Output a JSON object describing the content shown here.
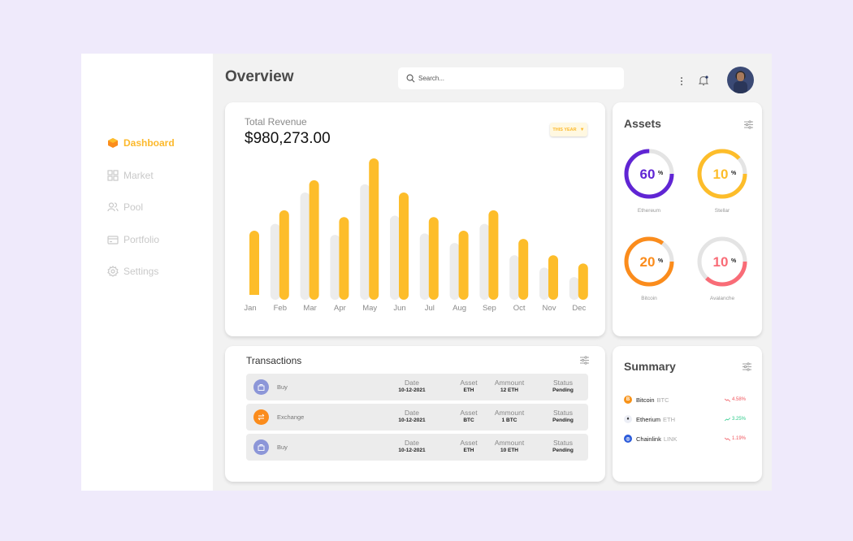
{
  "sidebar": {
    "items": [
      {
        "label": "Dashboard",
        "icon": "cube-icon",
        "active": true
      },
      {
        "label": "Market",
        "icon": "grid-icon",
        "active": false
      },
      {
        "label": "Pool",
        "icon": "users-icon",
        "active": false
      },
      {
        "label": "Portfolio",
        "icon": "card-icon",
        "active": false
      },
      {
        "label": "Settings",
        "icon": "gear-icon",
        "active": false
      }
    ]
  },
  "header": {
    "title": "Overview",
    "search_placeholder": "Search...",
    "search_value": ""
  },
  "revenue": {
    "label": "Total Revenue",
    "value": "$980,273.00",
    "period": "THIS YEAR"
  },
  "chart_data": {
    "type": "bar",
    "title": "Total Revenue",
    "categories": [
      "Jan",
      "Feb",
      "Mar",
      "Apr",
      "May",
      "Jun",
      "Jul",
      "Aug",
      "Sep",
      "Oct",
      "Nov",
      "Dec"
    ],
    "series": [
      {
        "name": "previous",
        "color": "#ececec",
        "values": [
          0,
          52,
          75,
          44,
          81,
          58,
          45,
          38,
          52,
          29,
          20,
          13
        ]
      },
      {
        "name": "current",
        "color": "#fdbd2a",
        "values": [
          47,
          62,
          84,
          57,
          100,
          75,
          57,
          47,
          62,
          41,
          29,
          23
        ]
      }
    ],
    "xlabel": "",
    "ylabel": "",
    "ylim": [
      0,
      100
    ],
    "grid": false
  },
  "assets": {
    "title": "Assets",
    "items": [
      {
        "name": "Ethereum",
        "percent": "60",
        "fill": 0.75,
        "color": "#6025d4"
      },
      {
        "name": "Stellar",
        "percent": "10",
        "fill": 0.88,
        "color": "#fdbd2a"
      },
      {
        "name": "Bitcoin",
        "percent": "20",
        "fill": 0.85,
        "color": "#fb8c1c"
      },
      {
        "name": "Avalanche",
        "percent": "10",
        "fill": 0.37,
        "color": "#f96c77"
      }
    ],
    "percent_sign": "%"
  },
  "transactions": {
    "title": "Transactions",
    "headers": {
      "date": "Date",
      "asset": "Asset",
      "amount": "Ammount",
      "status": "Status"
    },
    "rows": [
      {
        "type": "Buy",
        "icon": "bag-icon",
        "color": "#8c96d8",
        "date": "10-12-2021",
        "asset": "ETH",
        "amount": "12 ETH",
        "status": "Pending"
      },
      {
        "type": "Exchange",
        "icon": "exchange-icon",
        "color": "#fb8c1c",
        "date": "10-12-2021",
        "asset": "BTC",
        "amount": "1 BTC",
        "status": "Pending"
      },
      {
        "type": "Buy",
        "icon": "bag-icon",
        "color": "#8c96d8",
        "date": "10-12-2021",
        "asset": "ETH",
        "amount": "10 ETH",
        "status": "Pending"
      }
    ]
  },
  "summary": {
    "title": "Summary",
    "items": [
      {
        "name": "Bitcoin",
        "symbol": "BTC",
        "change": "4.58%",
        "direction": "down",
        "glyph": "B",
        "color": "#f7931a"
      },
      {
        "name": "Etherium",
        "symbol": "ETH",
        "change": "3.25%",
        "direction": "up",
        "glyph": "♦",
        "color": "#eceef5"
      },
      {
        "name": "Chainlink",
        "symbol": "LINK",
        "change": "1.19%",
        "direction": "down",
        "glyph": "◎",
        "color": "#2a5ada"
      }
    ]
  }
}
